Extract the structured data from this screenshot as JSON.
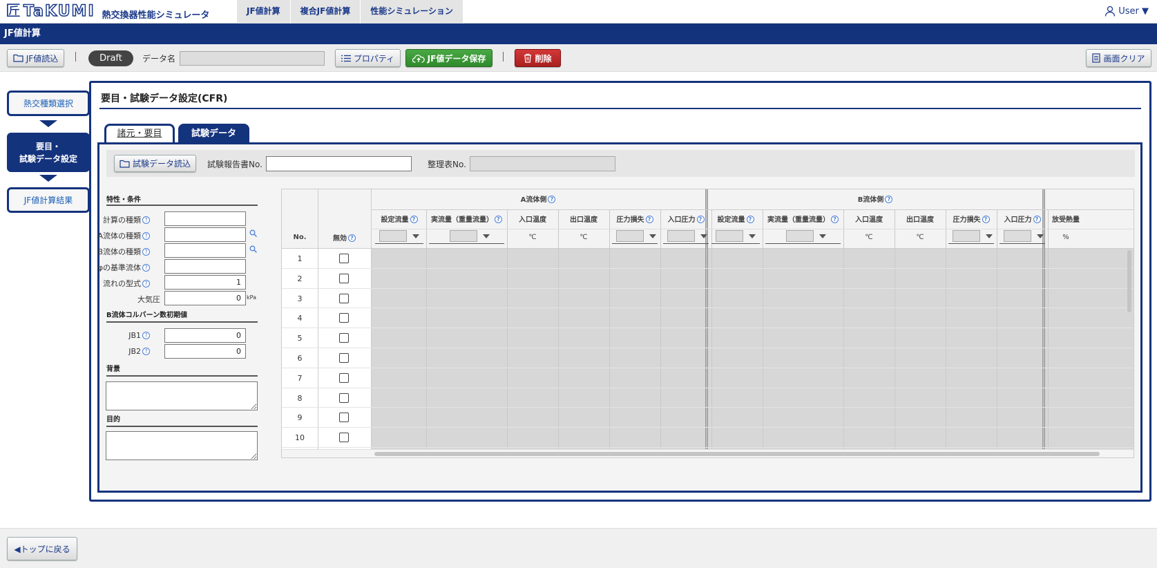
{
  "app": {
    "logo_mark": "匠",
    "logo_text": "TaKUMI",
    "subtitle": "熱交換器性能シミュレータ"
  },
  "nav": {
    "tabs": [
      "JF値計算",
      "複合JF値計算",
      "性能シミュレーション"
    ]
  },
  "user": {
    "label": "User ▼"
  },
  "page": {
    "title": "JF値計算"
  },
  "toolbar": {
    "load_label": "JF値読込",
    "status": "Draft",
    "data_name_label": "データ名",
    "data_name_value": "",
    "property_label": "プロパティ",
    "save_label": "JF値データ保存",
    "delete_label": "削除",
    "clear_label": "画面クリア"
  },
  "steps": [
    {
      "label": "熱交種類選択"
    },
    {
      "label_line1": "要目・",
      "label_line2": "試験データ設定"
    },
    {
      "label": "JF値計算結果"
    }
  ],
  "section": {
    "title": "要目・試験データ設定(CFR)"
  },
  "tabs": {
    "spec": "諸元・要目",
    "test": "試験データ"
  },
  "test_header": {
    "load_label": "試験データ読込",
    "report_no_label": "試験報告書No.",
    "report_no_value": "",
    "ref_no_label": "整理表No.",
    "ref_no_value": ""
  },
  "conditions": {
    "title": "特性・条件",
    "calc_type_label": "計算の種類",
    "fluid_a_label": "A流体の種類",
    "fluid_b_label": "B流体の種類",
    "phi_label": "φの基準流体",
    "flow_type_label": "流れの型式",
    "flow_type_value": "1",
    "atm_label": "大気圧",
    "atm_value": "0",
    "atm_unit": "kPa",
    "b_title": "B流体コルバーン数初期値",
    "jb1_label": "JB1",
    "jb1_value": "0",
    "jb2_label": "JB2",
    "jb2_value": "0",
    "bg_title": "背景",
    "purpose_title": "目的"
  },
  "grid": {
    "no_label": "No.",
    "invalid_label": "無効",
    "group_a": "A流体側",
    "group_b": "B流体側",
    "cols_a": [
      "設定流量",
      "実流量（重量流量）",
      "入口温度",
      "出口温度",
      "圧力損失",
      "入口圧力"
    ],
    "cols_b": [
      "設定流量",
      "実流量（重量流量）",
      "入口温度",
      "出口温度",
      "圧力損失",
      "入口圧力"
    ],
    "col_extra": "放受熱量",
    "unit_temp": "℃",
    "unit_pct": "%",
    "rows": [
      "1",
      "2",
      "3",
      "4",
      "5",
      "6",
      "7",
      "8",
      "9",
      "10"
    ]
  },
  "footer": {
    "back_label": "◀トップに戻る"
  },
  "colors": {
    "brand": "#14337d",
    "save": "#3a9a35",
    "delete": "#c02a2a"
  }
}
